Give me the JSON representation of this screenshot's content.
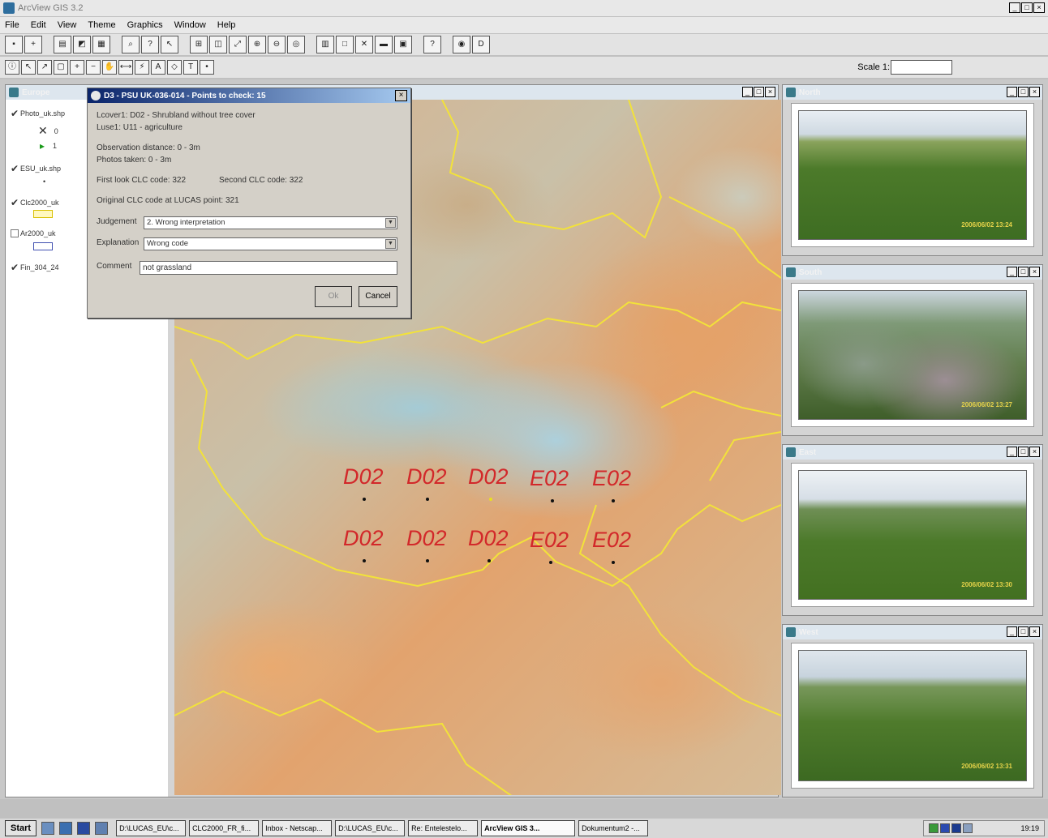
{
  "app": {
    "title": "ArcView GIS 3.2"
  },
  "menu": [
    "File",
    "Edit",
    "View",
    "Theme",
    "Graphics",
    "Window",
    "Help"
  ],
  "toolbar": {
    "scale_label": "Scale 1:",
    "scale_value": ""
  },
  "view": {
    "title": "Europe",
    "layers": [
      {
        "name": "Photo_uk.shp",
        "checked": true
      },
      {
        "name": "ESU_uk.shp",
        "checked": true
      },
      {
        "name": "Clc2000_uk",
        "checked": true
      },
      {
        "name": "Ar2000_uk",
        "checked": false
      },
      {
        "name": "Fin_304_24",
        "checked": true
      }
    ],
    "legend_values": [
      "0",
      "1"
    ]
  },
  "dialog": {
    "title": "D3 - PSU UK-036-014 - Points to check: 15",
    "lines": [
      "Lcover1: D02 - Shrubland without tree cover",
      "Luse1: U11 - agriculture",
      "Observation distance: 0 - 3m",
      "Photos taken: 0 - 3m",
      "First look CLC code: 322",
      "Second CLC code: 322",
      "Original CLC code at LUCAS point: 321"
    ],
    "judgement_label": "Judgement",
    "judgement_value": "2. Wrong interpretation",
    "explanation_label": "Explanation",
    "explanation_value": "Wrong code",
    "comment_label": "Comment",
    "comment_value": "not grassland",
    "ok_label": "Ok",
    "cancel_label": "Cancel"
  },
  "map_points": {
    "row1": [
      "D02",
      "D02",
      "D02",
      "E02",
      "E02"
    ],
    "row2": [
      "D02",
      "D02",
      "D02",
      "E02",
      "E02"
    ]
  },
  "photos": [
    {
      "title": "North",
      "stamp": "2006/06/02 13:24"
    },
    {
      "title": "South",
      "stamp": "2006/06/02 13:27"
    },
    {
      "title": "East",
      "stamp": "2006/06/02 13:30"
    },
    {
      "title": "West",
      "stamp": "2006/06/02 13:31"
    }
  ],
  "taskbar": {
    "start": "Start",
    "tasks": [
      "D:\\LUCAS_EU\\c...",
      "CLC2000_FR_fi...",
      "Inbox - Netscap...",
      "D:\\LUCAS_EU\\c...",
      "Re: Entelestelo...",
      "ArcView GIS 3...",
      "Dokumentum2 -..."
    ],
    "clock": "19:19"
  }
}
